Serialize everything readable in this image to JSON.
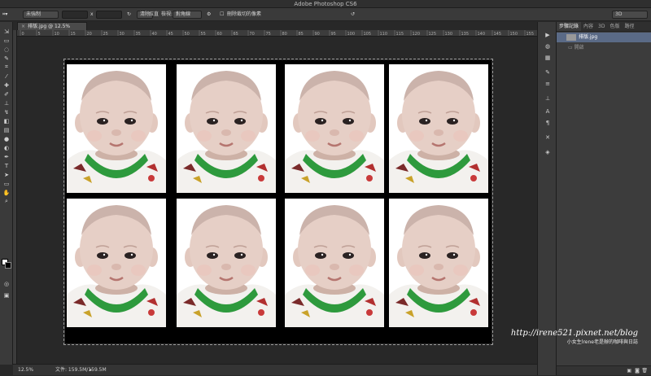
{
  "app": {
    "title": "Adobe Photoshop CS6"
  },
  "options_bar": {
    "style_select": "未強制",
    "ratio_value": "x",
    "clear_button": "清除",
    "straighten_label": "拉直",
    "view_label": "檢視:",
    "view_select": "對角線",
    "delete_cropped_label": "刪除裁切的像素",
    "workspace_select": "3D"
  },
  "document_tab": {
    "name": "排版.jpg @ 12.5% (RGB/8) *",
    "close": "×"
  },
  "ruler_marks": [
    "0",
    "5",
    "10",
    "15",
    "20",
    "25",
    "30",
    "35",
    "40",
    "45",
    "50",
    "55",
    "60",
    "65",
    "70",
    "75",
    "80",
    "85",
    "90",
    "95",
    "100",
    "105",
    "110",
    "115",
    "120",
    "125",
    "130",
    "135",
    "140",
    "145",
    "150",
    "155"
  ],
  "toolbox": {
    "tools": [
      "move-icon",
      "marquee-icon",
      "lasso-icon",
      "quick-select-icon",
      "crop-icon",
      "eyedropper-icon",
      "healing-icon",
      "brush-icon",
      "stamp-icon",
      "history-brush-icon",
      "eraser-icon",
      "gradient-icon",
      "blur-icon",
      "dodge-icon",
      "pen-icon",
      "type-icon",
      "path-select-icon",
      "shape-icon",
      "hand-icon",
      "zoom-icon"
    ]
  },
  "status_bar": {
    "zoom": "12.5%",
    "doc_info": "文件: 159.5M/159.5M"
  },
  "right_panel": {
    "tabs": [
      "步驟記錄",
      "內容",
      "3D",
      "色版",
      "路徑"
    ],
    "history_items": [
      {
        "label": "排版.jpg",
        "selected": true
      },
      {
        "label": "開啟",
        "selected": false
      }
    ]
  },
  "watermark": {
    "url": "http://irene521.pixnet.net/blog",
    "subtitle": "小女生lrene老是辦的咖啡與日誌"
  },
  "colors": {
    "app_bg": "#282828",
    "panel_bg": "#3c3c3c",
    "selected_row": "#5a6a86",
    "shirt_green": "#2e9a3d"
  }
}
